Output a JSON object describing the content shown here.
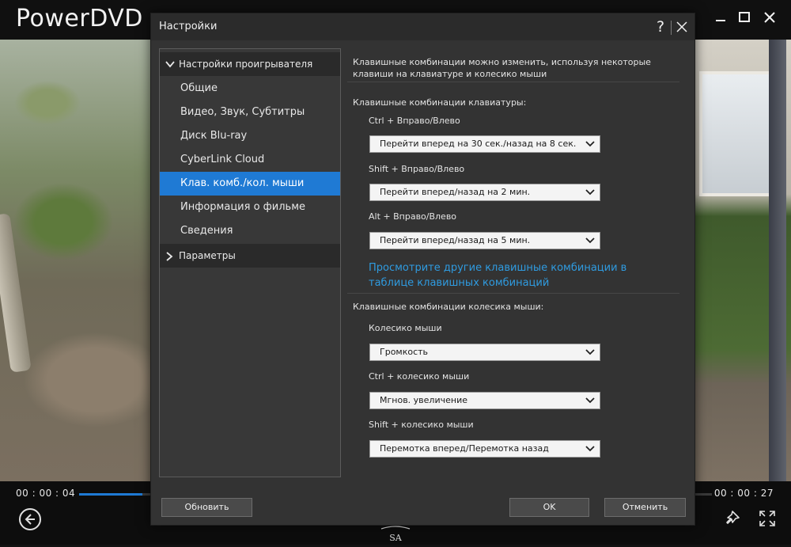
{
  "app": {
    "title": "PowerDVD",
    "time_current": "00 : 00 : 04",
    "time_total": "00 : 00 : 27",
    "progress_fraction": 0.1,
    "accent_color": "#1f7ad4",
    "link_color": "#2f9be0",
    "watermark_text": "SA"
  },
  "dialog": {
    "title": "Настройки",
    "help_label": "?",
    "nav": {
      "header_player": "Настройки проигрывателя",
      "items": [
        {
          "label": "Общие"
        },
        {
          "label": "Видео, Звук, Субтитры"
        },
        {
          "label": "Диск Blu-ray"
        },
        {
          "label": "CyberLink Cloud"
        },
        {
          "label": "Клав. комб./кол. мыши"
        },
        {
          "label": "Информация о фильме"
        },
        {
          "label": "Сведения"
        }
      ],
      "active_index": 4,
      "header_params": "Параметры"
    },
    "content": {
      "intro": "Клавишные комбинации можно изменить, используя некоторые клавиши на клавиатуре и колесико мыши",
      "keyboard_section": "Клавишные комбинации клавиатуры:",
      "keyboard": [
        {
          "label": "Ctrl + Вправо/Влево",
          "value": "Перейти вперед на 30 сек./назад на 8 сек."
        },
        {
          "label": "Shift + Вправо/Влево",
          "value": "Перейти вперед/назад на 2 мин."
        },
        {
          "label": "Alt + Вправо/Влево",
          "value": "Перейти вперед/назад на 5 мин."
        }
      ],
      "link": "Просмотрите другие клавишные комбинации в таблице клавишных комбинаций",
      "mouse_section": "Клавишные комбинации колесика мыши:",
      "mouse": [
        {
          "label": "Колесико мыши",
          "value": "Громкость"
        },
        {
          "label": "Ctrl + колесико мыши",
          "value": "Мгнов. увеличение"
        },
        {
          "label": "Shift + колесико мыши",
          "value": "Перемотка вперед/Перемотка назад"
        }
      ]
    },
    "buttons": {
      "refresh": "Обновить",
      "ok": "OK",
      "cancel": "Отменить"
    }
  }
}
